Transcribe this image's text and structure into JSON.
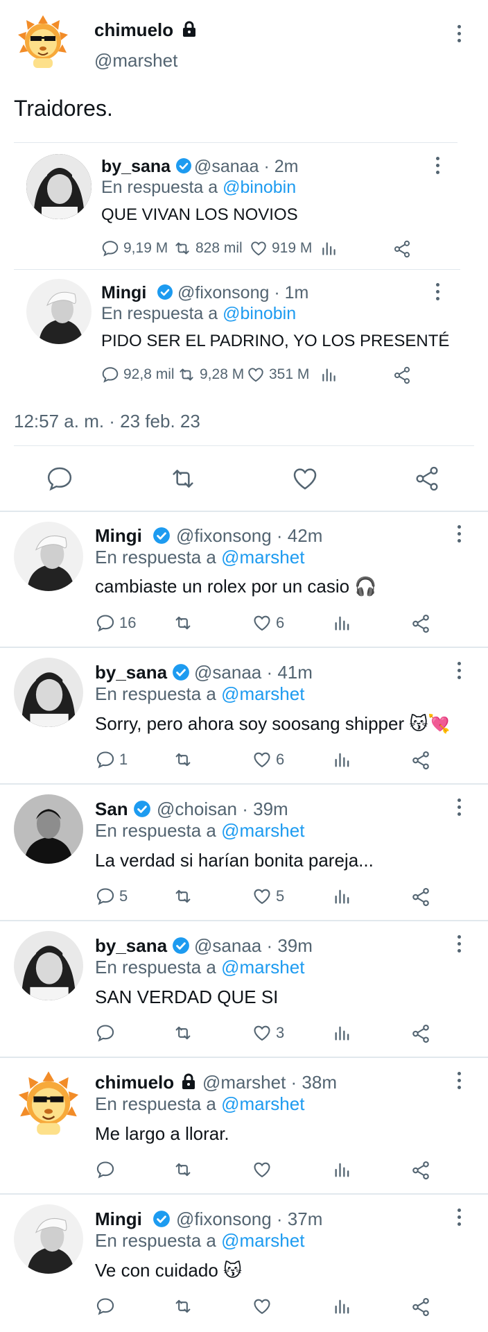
{
  "main_tweet": {
    "name": "chimuelo",
    "handle": "@marshet",
    "text": "Traidores.",
    "timestamp": "12:57 a. m. · 23 feb. 23"
  },
  "quoted": [
    {
      "name": "by_sana",
      "handle": "@sanaa · 2m",
      "reply_prefix": "En respuesta a ",
      "mention": "@binobin",
      "text": "QUE VIVAN LOS NOVIOS",
      "replies": "9,19 M",
      "retweets": "828 mil",
      "likes": "919 M"
    },
    {
      "name": "Mingi",
      "handle": "@fixonsong · 1m",
      "reply_prefix": "En respuesta a ",
      "mention": "@binobin",
      "text": "PIDO SER EL PADRINO, YO LOS PRESENTÉ",
      "replies": "92,8 mil",
      "retweets": "9,28 M",
      "likes": "351 M"
    }
  ],
  "replies": [
    {
      "name": "Mingi",
      "handle": "@fixonsong · 42m",
      "reply_prefix": "En respuesta a ",
      "mention": "@marshet",
      "text": "cambiaste un rolex por un casio 🎧",
      "replies": "16",
      "retweets": "",
      "likes": "6"
    },
    {
      "name": "by_sana",
      "handle": "@sanaa · 41m",
      "reply_prefix": "En respuesta a ",
      "mention": "@marshet",
      "text": "Sorry, pero ahora soy soosang shipper 😽💘",
      "replies": "1",
      "retweets": "",
      "likes": "6"
    },
    {
      "name": "San",
      "handle": "@choisan · 39m",
      "reply_prefix": "En respuesta a ",
      "mention": "@marshet",
      "text": "La verdad si harían bonita pareja...",
      "replies": "5",
      "retweets": "",
      "likes": "5"
    },
    {
      "name": "by_sana",
      "handle": "@sanaa · 39m",
      "reply_prefix": "En respuesta a ",
      "mention": "@marshet",
      "text": "SAN VERDAD QUE SI",
      "replies": "",
      "retweets": "",
      "likes": "3"
    },
    {
      "name": "chimuelo",
      "handle": "@marshet · 38m",
      "reply_prefix": "En respuesta a ",
      "mention": "@marshet",
      "text": "Me largo a llorar.",
      "replies": "",
      "retweets": "",
      "likes": ""
    },
    {
      "name": "Mingi",
      "handle": "@fixonsong · 37m",
      "reply_prefix": "En respuesta a ",
      "mention": "@marshet",
      "text": "Ve con cuidado 😽",
      "replies": "",
      "retweets": "",
      "likes": ""
    }
  ],
  "colors": {
    "accent": "#1d9bf0",
    "secondary_text": "#536471",
    "divider": "#e1e8ed"
  },
  "icons": [
    "lion-avatar",
    "lock-icon",
    "verified-badge-icon",
    "reply-icon",
    "retweet-icon",
    "like-icon",
    "views-icon",
    "share-icon",
    "more-icon"
  ]
}
